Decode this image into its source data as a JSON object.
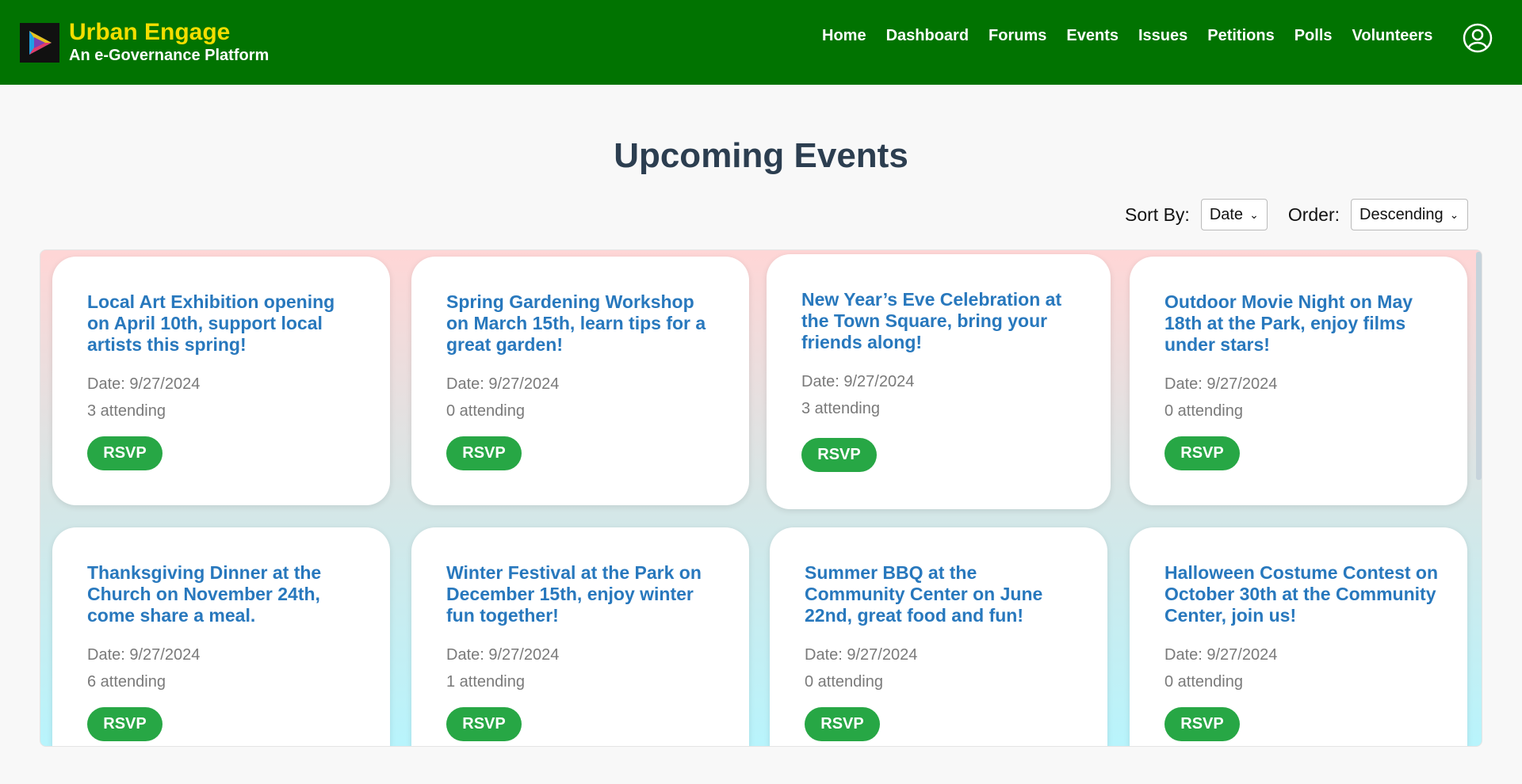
{
  "header": {
    "brand_title": "Urban Engage",
    "brand_subtitle": "An e-Governance Platform",
    "nav": [
      "Home",
      "Dashboard",
      "Forums",
      "Events",
      "Issues",
      "Petitions",
      "Polls",
      "Volunteers"
    ]
  },
  "main": {
    "title": "Upcoming Events",
    "sort_label": "Sort By:",
    "sort_value": "Date",
    "order_label": "Order:",
    "order_value": "Descending",
    "rsvp_label": "RSVP",
    "events": [
      {
        "title": "Local Art Exhibition opening on April 10th, support local artists this spring!",
        "date": "Date: 9/27/2024",
        "attending": "3 attending"
      },
      {
        "title": "Spring Gardening Workshop on March 15th, learn tips for a great garden!",
        "date": "Date: 9/27/2024",
        "attending": "0 attending"
      },
      {
        "title": "New Year’s Eve Celebration at the Town Square, bring your friends along!",
        "date": "Date: 9/27/2024",
        "attending": "3 attending"
      },
      {
        "title": "Outdoor Movie Night on May 18th at the Park, enjoy films under stars!",
        "date": "Date: 9/27/2024",
        "attending": "0 attending"
      },
      {
        "title": "Thanksgiving Dinner at the Church on November 24th, come share a meal.",
        "date": "Date: 9/27/2024",
        "attending": "6 attending"
      },
      {
        "title": "Winter Festival at the Park on December 15th, enjoy winter fun together!",
        "date": "Date: 9/27/2024",
        "attending": "1 attending"
      },
      {
        "title": "Summer BBQ at the Community Center on June 22nd, great food and fun!",
        "date": "Date: 9/27/2024",
        "attending": "0 attending"
      },
      {
        "title": "Halloween Costume Contest on October 30th at the Community Center, join us!",
        "date": "Date: 9/27/2024",
        "attending": "0 attending"
      }
    ]
  },
  "colors": {
    "header_bg": "#017301",
    "brand_title": "#f3de00",
    "event_title": "#2878bd",
    "rsvp": "#27a745",
    "page_title": "#2c3e50"
  },
  "icons": {
    "logo": "play-triangle-logo",
    "profile": "user-circle-icon",
    "select_chevron": "chevron-down-icon"
  }
}
